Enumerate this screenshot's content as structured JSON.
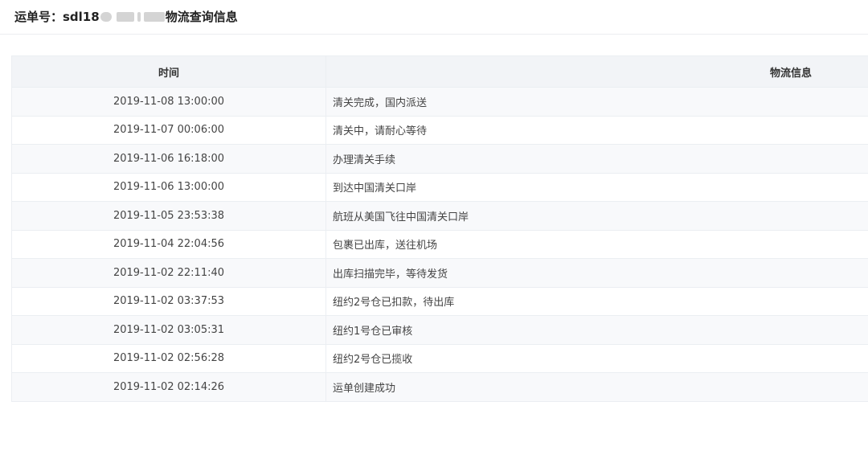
{
  "header": {
    "title_prefix": "运单号：sdl18",
    "title_suffix": "物流查询信息"
  },
  "table": {
    "columns": [
      "时间",
      "物流信息"
    ],
    "rows": [
      {
        "time": "2019-11-08 13:00:00",
        "info": "清关完成，国内派送"
      },
      {
        "time": "2019-11-07 00:06:00",
        "info": "清关中，请耐心等待"
      },
      {
        "time": "2019-11-06 16:18:00",
        "info": "办理清关手续"
      },
      {
        "time": "2019-11-06 13:00:00",
        "info": "到达中国清关口岸"
      },
      {
        "time": "2019-11-05 23:53:38",
        "info": "航班从美国飞往中国清关口岸"
      },
      {
        "time": "2019-11-04 22:04:56",
        "info": "包裹已出库，送往机场"
      },
      {
        "time": "2019-11-02 22:11:40",
        "info": "出库扫描完毕，等待发货"
      },
      {
        "time": "2019-11-02 03:37:53",
        "info": "纽约2号仓已扣款，待出库"
      },
      {
        "time": "2019-11-02 03:05:31",
        "info": "纽约1号仓已审核"
      },
      {
        "time": "2019-11-02 02:56:28",
        "info": "纽约2号仓已揽收"
      },
      {
        "time": "2019-11-02 02:14:26",
        "info": "运单创建成功"
      }
    ]
  }
}
